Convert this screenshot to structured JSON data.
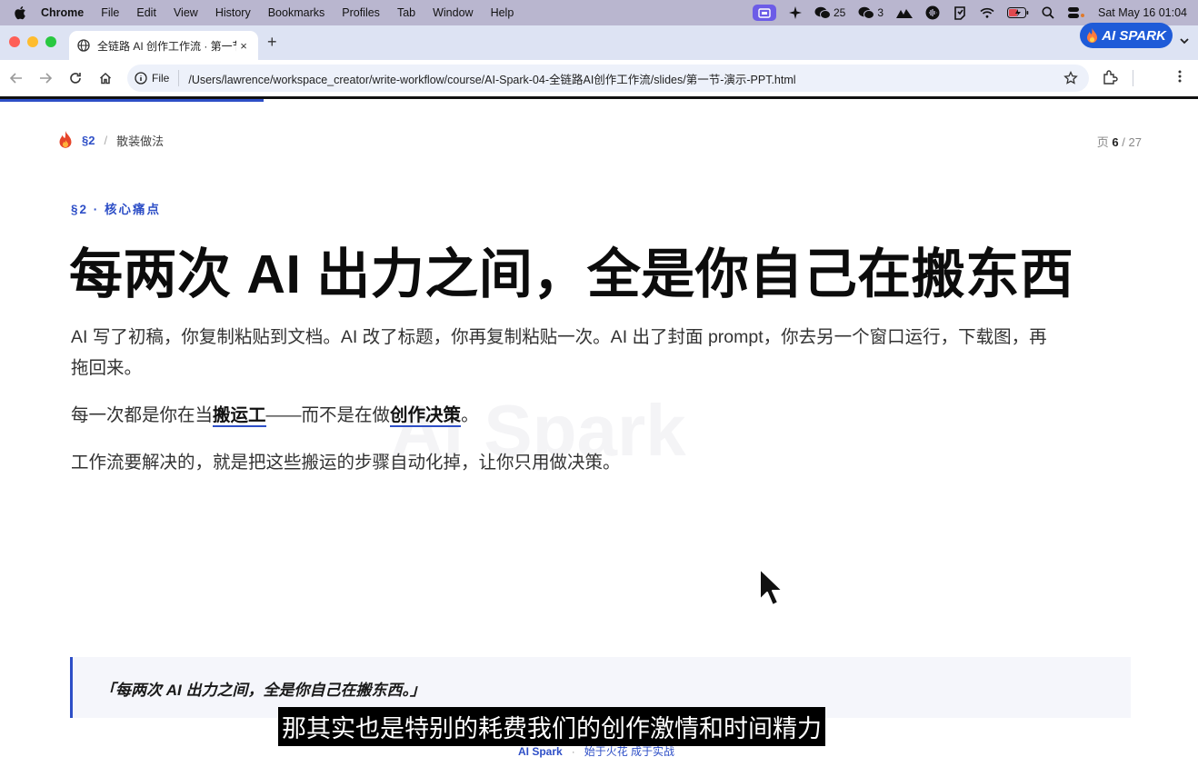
{
  "menubar": {
    "app_name": "Chrome",
    "items": [
      "File",
      "Edit",
      "View",
      "History",
      "Bookmarks",
      "Profiles",
      "Tab",
      "Window",
      "Help"
    ],
    "wechat_count_1": "25",
    "wechat_count_2": "3",
    "clock": "Sat May 16  01:04"
  },
  "browser": {
    "tab_title": "全链路 AI 创作工作流 · 第一节 ·",
    "tab_close": "×",
    "new_tab": "+",
    "brand_badge": "AI SPARK",
    "scheme_chip": "File",
    "url": "/Users/lawrence/workspace_creator/write-workflow/course/AI-Spark-04-全链路AI创作工作流/slides/第一节-演示-PPT.html"
  },
  "slide": {
    "progress_fraction": 0.22,
    "breadcrumb_section": "§2",
    "breadcrumb_sep": "/",
    "breadcrumb_page": "散装做法",
    "page_label": "页",
    "page_current": "6",
    "page_sep": "/",
    "page_total": "27",
    "watermark": "AI Spark",
    "eyebrow": "§2 · 核心痛点",
    "headline": "每两次 AI 出力之间，全是你自己在搬东西",
    "para1": "AI 写了初稿，你复制粘贴到文档。AI 改了标题，你再复制粘贴一次。AI 出了封面 prompt，你去另一个窗口运行，下载图，再拖回来。",
    "para2_a": "每一次都是你在当",
    "para2_em1": "搬运工",
    "para2_b": "——而不是在做",
    "para2_em2": "创作决策",
    "para2_c": "。",
    "para3": "工作流要解决的，就是把这些搬运的步骤自动化掉，让你只用做决策。",
    "quote": "「每两次 AI 出力之间，全是你自己在搬东西。」",
    "footer_brand": "AI Spark",
    "footer_dot": "·",
    "footer_slogan": "始于火花 成于实战"
  },
  "subtitle": "那其实也是特别的耗费我们的创作激情和时间精力",
  "colors": {
    "accent": "#2e4fc7",
    "menubar": "#b9b6cf",
    "tabstrip": "#dde3f3",
    "badge": "#1e5bd8"
  }
}
